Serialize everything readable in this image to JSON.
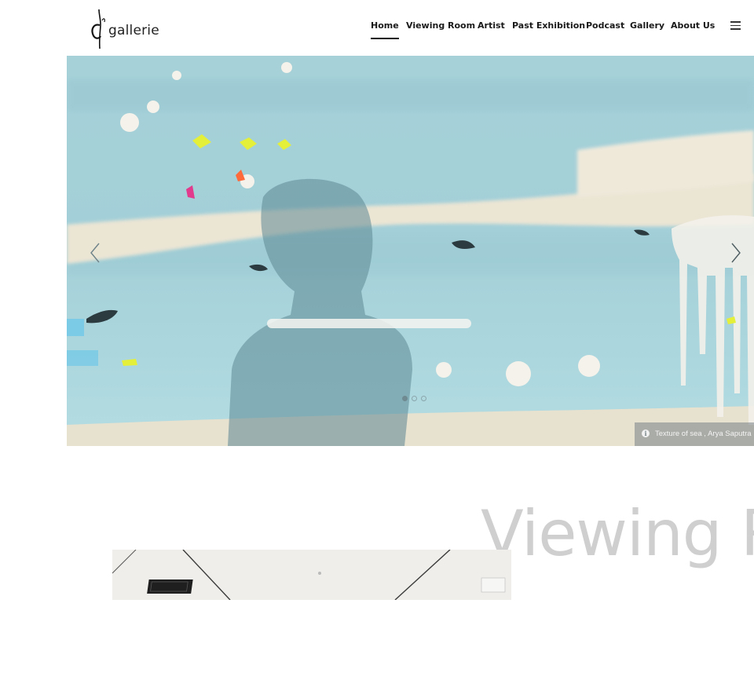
{
  "brand": {
    "logo_text": "gallerie",
    "logo_mark": "d"
  },
  "nav": {
    "items": [
      {
        "label": "Home",
        "active": true
      },
      {
        "label": "Viewing Room"
      },
      {
        "label": "Artist"
      },
      {
        "label": "Past Exhibition"
      },
      {
        "label": "Podcast"
      },
      {
        "label": "Gallery"
      },
      {
        "label": "About Us"
      }
    ],
    "menu_icon": "hamburger-icon"
  },
  "hero": {
    "caption": "Texture of sea , Arya Saputra",
    "info_icon": "info-icon",
    "prev_icon": "chevron-left-icon",
    "next_icon": "chevron-right-icon",
    "slides_total": 3,
    "active_slide": 1,
    "colors": {
      "sky": "#a9d3db",
      "cream": "#ece6d6"
    }
  },
  "viewing_room": {
    "title": "Viewing R"
  }
}
